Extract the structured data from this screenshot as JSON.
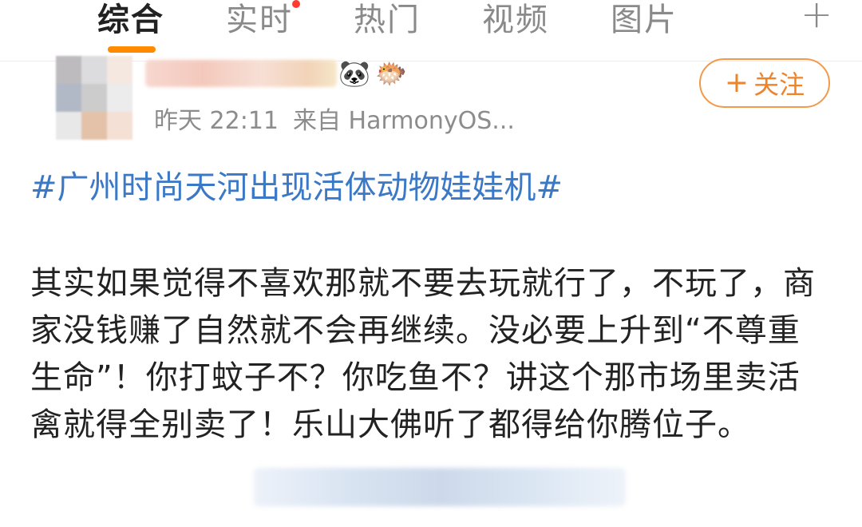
{
  "tabs": [
    {
      "label": "综合",
      "active": true
    },
    {
      "label": "实时",
      "active": false
    },
    {
      "label": "热门",
      "active": false
    },
    {
      "label": "视频",
      "active": false
    },
    {
      "label": "图片",
      "active": false
    }
  ],
  "add_tab_icon": "plus-icon",
  "accent_color": "#ff8a00",
  "post": {
    "emojis": [
      "🐼",
      "🐡"
    ],
    "time": "昨天 22:11",
    "source": "来自 HarmonyOS...",
    "follow_label": "关注",
    "topic": "#广州时尚天河出现活体动物娃娃机#",
    "content": "其实如果觉得不喜欢那就不要去玩就行了，不玩了，商家没钱赚了自然就不会再继续。没必要上升到“不尊重生命”！你打蚊子不？你吃鱼不？讲这个那市场里卖活禽就得全别卖了！乐山大佛听了都得给你腾位子。"
  }
}
